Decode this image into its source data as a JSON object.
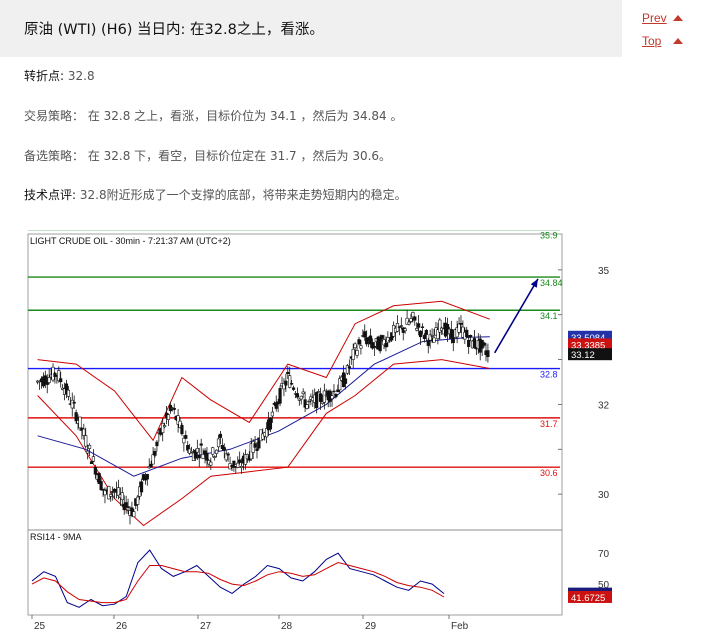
{
  "page": {
    "title": "原油 (WTI) (H6) 当日内: 在32.8之上，看涨。",
    "nav": {
      "prev": "Prev",
      "top": "Top"
    },
    "pivot": {
      "label": "转折点:",
      "value": "32.8"
    },
    "strategy": "交易策略： 在 32.8 之上，看涨，目标价位为 34.1 ，然后为 34.84 。",
    "alternative": "备选策略： 在 32.8 下，看空，目标价位定在 31.7 ，然后为 30.6。",
    "comment": {
      "label": "技术点评:",
      "text": "32.8附近形成了一个支撑的底部，将带来走势短期内的稳定。"
    }
  },
  "colors": {
    "support": "#1a1aff",
    "target": "#1a8a1a",
    "downside": "#e01010",
    "bollinger": "#cc0000",
    "ma": "#1a1a9a",
    "arrow": "#00008b",
    "rsi": "#00008b",
    "rsi_ma": "#cc0000"
  },
  "chart_data": [
    {
      "type": "candlestick",
      "title": "LIGHT CRUDE OIL - 30min - 7:21:37 AM (UTC+2)",
      "xlabel": "",
      "ylabel": "",
      "ylim": [
        29.2,
        35.8
      ],
      "x_ticks": [
        "25",
        "26",
        "27",
        "28",
        "29",
        "Feb"
      ],
      "y_ticks": [
        30,
        31,
        32,
        33,
        34,
        35
      ],
      "y_tick_labels": [
        "30",
        "",
        "32",
        "",
        "",
        "35"
      ],
      "horizontal_levels": [
        {
          "value": 35.9,
          "label": "35.9",
          "role": "target"
        },
        {
          "value": 34.84,
          "label": "34.84",
          "role": "target"
        },
        {
          "value": 34.1,
          "label": "34.1",
          "role": "target"
        },
        {
          "value": 32.8,
          "label": "32.8",
          "role": "support"
        },
        {
          "value": 31.7,
          "label": "31.7",
          "role": "downside"
        },
        {
          "value": 30.6,
          "label": "30.6",
          "role": "downside"
        }
      ],
      "value_badges": [
        {
          "value": 33.5084,
          "label": "33.5084",
          "role": "ma"
        },
        {
          "value": 33.3385,
          "label": "33.3385",
          "role": "bollinger"
        },
        {
          "value": 33.12,
          "label": "33.12",
          "role": "last"
        }
      ],
      "price_path": [
        {
          "x": 0.0,
          "y": 32.5
        },
        {
          "x": 0.2,
          "y": 32.6
        },
        {
          "x": 0.4,
          "y": 32.7
        },
        {
          "x": 0.6,
          "y": 32.3
        },
        {
          "x": 0.8,
          "y": 31.8
        },
        {
          "x": 1.0,
          "y": 31.2
        },
        {
          "x": 1.2,
          "y": 30.6
        },
        {
          "x": 1.4,
          "y": 30.0
        },
        {
          "x": 1.6,
          "y": 30.1
        },
        {
          "x": 1.8,
          "y": 29.8
        },
        {
          "x": 2.0,
          "y": 29.6
        },
        {
          "x": 2.2,
          "y": 30.3
        },
        {
          "x": 2.4,
          "y": 30.8
        },
        {
          "x": 2.6,
          "y": 31.5
        },
        {
          "x": 2.8,
          "y": 31.9
        },
        {
          "x": 3.0,
          "y": 31.4
        },
        {
          "x": 3.2,
          "y": 30.9
        },
        {
          "x": 3.4,
          "y": 31.0
        },
        {
          "x": 3.6,
          "y": 30.8
        },
        {
          "x": 3.8,
          "y": 31.2
        },
        {
          "x": 4.0,
          "y": 30.7
        },
        {
          "x": 4.2,
          "y": 30.6
        },
        {
          "x": 4.4,
          "y": 30.9
        },
        {
          "x": 4.6,
          "y": 31.2
        },
        {
          "x": 4.8,
          "y": 31.5
        },
        {
          "x": 5.0,
          "y": 32.1
        },
        {
          "x": 5.2,
          "y": 32.6
        },
        {
          "x": 5.4,
          "y": 32.3
        },
        {
          "x": 5.6,
          "y": 32.0
        },
        {
          "x": 5.8,
          "y": 32.1
        },
        {
          "x": 6.0,
          "y": 32.2
        },
        {
          "x": 6.2,
          "y": 32.3
        },
        {
          "x": 6.4,
          "y": 32.6
        },
        {
          "x": 6.6,
          "y": 33.2
        },
        {
          "x": 6.8,
          "y": 33.5
        },
        {
          "x": 7.0,
          "y": 33.3
        },
        {
          "x": 7.2,
          "y": 33.4
        },
        {
          "x": 7.4,
          "y": 33.6
        },
        {
          "x": 7.6,
          "y": 33.7
        },
        {
          "x": 7.8,
          "y": 33.9
        },
        {
          "x": 8.0,
          "y": 33.6
        },
        {
          "x": 8.2,
          "y": 33.4
        },
        {
          "x": 8.4,
          "y": 33.8
        },
        {
          "x": 8.6,
          "y": 33.5
        },
        {
          "x": 8.8,
          "y": 33.7
        },
        {
          "x": 9.0,
          "y": 33.4
        },
        {
          "x": 9.2,
          "y": 33.3
        },
        {
          "x": 9.4,
          "y": 33.12
        }
      ],
      "ma_path": [
        {
          "x": 0.0,
          "y": 31.3
        },
        {
          "x": 1.0,
          "y": 31.0
        },
        {
          "x": 2.0,
          "y": 30.4
        },
        {
          "x": 3.0,
          "y": 30.8
        },
        {
          "x": 4.0,
          "y": 31.0
        },
        {
          "x": 5.0,
          "y": 31.4
        },
        {
          "x": 6.0,
          "y": 32.0
        },
        {
          "x": 7.0,
          "y": 32.9
        },
        {
          "x": 8.0,
          "y": 33.4
        },
        {
          "x": 9.0,
          "y": 33.5
        },
        {
          "x": 9.4,
          "y": 33.5084
        }
      ],
      "bollinger_upper": [
        {
          "x": 0.0,
          "y": 33.0
        },
        {
          "x": 0.8,
          "y": 32.9
        },
        {
          "x": 1.6,
          "y": 32.3
        },
        {
          "x": 2.4,
          "y": 31.2
        },
        {
          "x": 3.0,
          "y": 32.6
        },
        {
          "x": 3.6,
          "y": 32.1
        },
        {
          "x": 4.4,
          "y": 31.6
        },
        {
          "x": 5.2,
          "y": 32.9
        },
        {
          "x": 6.0,
          "y": 32.6
        },
        {
          "x": 6.6,
          "y": 33.8
        },
        {
          "x": 7.4,
          "y": 34.2
        },
        {
          "x": 8.4,
          "y": 34.3
        },
        {
          "x": 9.4,
          "y": 33.9
        }
      ],
      "bollinger_lower": [
        {
          "x": 0.0,
          "y": 32.2
        },
        {
          "x": 0.8,
          "y": 31.3
        },
        {
          "x": 1.6,
          "y": 29.9
        },
        {
          "x": 2.2,
          "y": 29.3
        },
        {
          "x": 3.0,
          "y": 29.9
        },
        {
          "x": 3.6,
          "y": 30.4
        },
        {
          "x": 4.4,
          "y": 30.5
        },
        {
          "x": 5.2,
          "y": 30.6
        },
        {
          "x": 6.0,
          "y": 31.8
        },
        {
          "x": 6.6,
          "y": 32.2
        },
        {
          "x": 7.4,
          "y": 32.9
        },
        {
          "x": 8.4,
          "y": 33.0
        },
        {
          "x": 9.4,
          "y": 32.8
        }
      ],
      "arrow": {
        "from": {
          "x": 9.5,
          "y": 33.15
        },
        "to": {
          "x": 10.4,
          "y": 34.8
        }
      }
    },
    {
      "type": "line",
      "title": "RSI14 - 9MA",
      "ylim": [
        30,
        85
      ],
      "y_ticks": [
        50,
        70
      ],
      "x_ticks": [
        "25",
        "26",
        "27",
        "28",
        "29",
        "Feb"
      ],
      "value_badges": [
        {
          "value": 43.8364,
          "label": "43.8364",
          "role": "rsi"
        },
        {
          "value": 41.6725,
          "label": "41.6725",
          "role": "rsi_ma"
        }
      ],
      "series": [
        {
          "values": [
            52,
            58,
            55,
            38,
            35,
            40,
            36,
            37,
            42,
            64,
            72,
            60,
            55,
            58,
            62,
            55,
            48,
            44,
            50,
            55,
            62,
            60,
            54,
            52,
            58,
            66,
            70,
            60,
            58,
            56,
            52,
            48,
            46,
            52,
            50,
            43.8364
          ]
        },
        {
          "values": [
            50,
            54,
            52,
            45,
            40,
            39,
            38,
            38,
            40,
            52,
            62,
            62,
            60,
            58,
            58,
            57,
            53,
            50,
            49,
            52,
            56,
            58,
            57,
            55,
            56,
            60,
            64,
            62,
            60,
            58,
            55,
            51,
            49,
            48,
            46,
            41.6725
          ]
        }
      ]
    }
  ]
}
